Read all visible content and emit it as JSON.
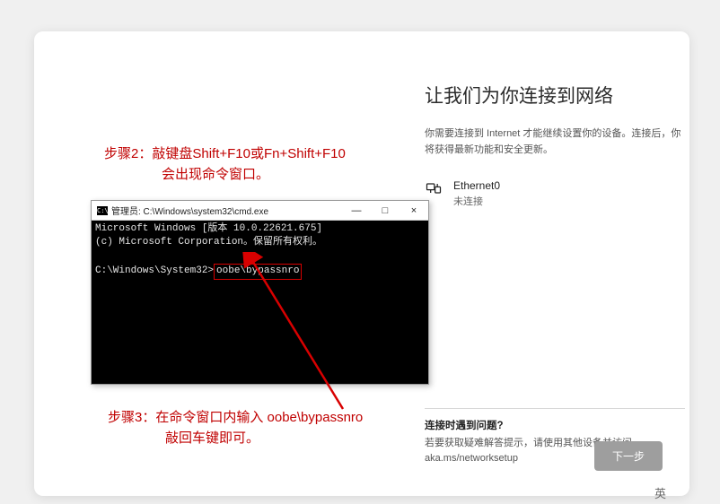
{
  "oobe": {
    "heading": "让我们为你连接到网络",
    "subtext": "你需要连接到 Internet 才能继续设置你的设备。连接后，你将获得最新功能和安全更新。",
    "network": {
      "name": "Ethernet0",
      "status": "未连接"
    },
    "trouble": {
      "title": "连接时遇到问题?",
      "text": "若要获取疑难解答提示，请使用其他设备并访问 aka.ms/networksetup"
    },
    "next_button": "下一步"
  },
  "annotations": {
    "step2_line1": "步骤2：敲键盘Shift+F10或Fn+Shift+F10",
    "step2_line2": "会出现命令窗口。",
    "step3_line1": "步骤3：在命令窗口内输入 oobe\\bypassnro",
    "step3_line2": "敲回车键即可。"
  },
  "cmd": {
    "title": "管理员: C:\\Windows\\system32\\cmd.exe",
    "min": "—",
    "max": "□",
    "close": "×",
    "line1": "Microsoft Windows [版本 10.0.22621.675]",
    "line2": "(c) Microsoft Corporation。保留所有权利。",
    "prompt": "C:\\Windows\\System32>",
    "command": "oobe\\bypassnro"
  },
  "footer": "英"
}
